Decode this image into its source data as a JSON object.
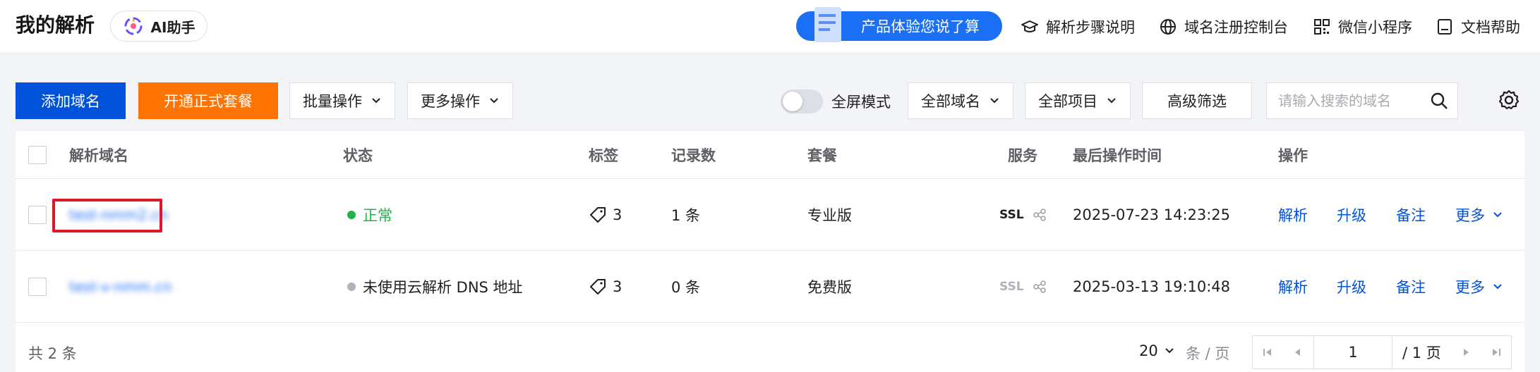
{
  "header": {
    "title": "我的解析",
    "ai_button": "AI助手",
    "feedback": "产品体验您说了算",
    "links": [
      {
        "label": "解析步骤说明",
        "icon": "graduation-cap-icon"
      },
      {
        "label": "域名注册控制台",
        "icon": "globe-icon"
      },
      {
        "label": "微信小程序",
        "icon": "qr-code-icon"
      },
      {
        "label": "文档帮助",
        "icon": "document-icon"
      }
    ]
  },
  "toolbar": {
    "add_domain": "添加域名",
    "open_package": "开通正式套餐",
    "batch_ops": "批量操作",
    "more_ops": "更多操作",
    "fullscreen": "全屏模式",
    "all_domains": "全部域名",
    "all_projects": "全部项目",
    "advanced_filter": "高级筛选",
    "search_placeholder": "请输入搜索的域名"
  },
  "table": {
    "columns": [
      "解析域名",
      "状态",
      "标签",
      "记录数",
      "套餐",
      "服务",
      "最后操作时间",
      "操作"
    ],
    "rows": [
      {
        "domain": "test-nmm2.cn",
        "status": "正常",
        "status_color": "#1fb34a",
        "tags": "3",
        "records": "1 条",
        "plan": "专业版",
        "ssl": "SSL",
        "ssl_active": true,
        "time": "2025-07-23 14:23:25",
        "ops": [
          "解析",
          "升级",
          "备注",
          "更多"
        ]
      },
      {
        "domain": "test-v-nmm.cn",
        "status": "未使用云解析 DNS 地址",
        "status_color": "#b0b3b9",
        "tags": "3",
        "records": "0 条",
        "plan": "免费版",
        "ssl": "SSL",
        "ssl_active": false,
        "time": "2025-03-13 19:10:48",
        "ops": [
          "解析",
          "升级",
          "备注",
          "更多"
        ]
      }
    ]
  },
  "footer": {
    "total": "共 2 条",
    "page_size": "20",
    "page_unit": "条 / 页",
    "current_page": "1",
    "total_pages": "/ 1 页"
  },
  "colors": {
    "primary": "#0052d9",
    "orange": "#ff7300",
    "link": "#0052d9",
    "highlight_box": "#e0162b"
  }
}
